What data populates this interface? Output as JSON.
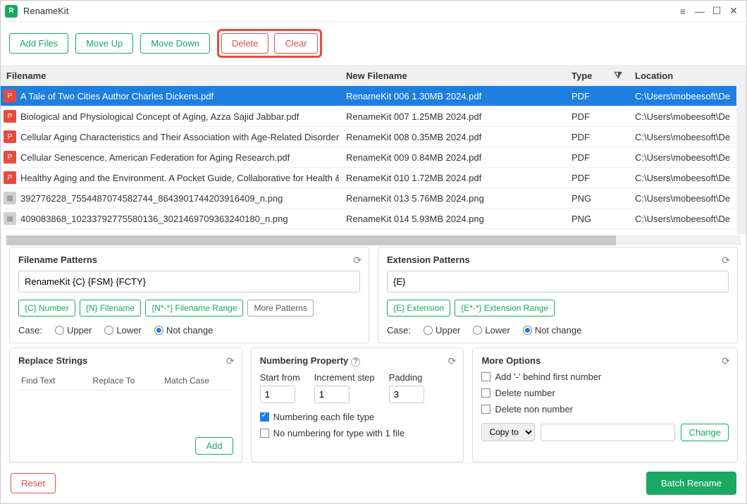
{
  "app": {
    "title": "RenameKit"
  },
  "toolbar": {
    "add_files": "Add Files",
    "move_up": "Move Up",
    "move_down": "Move Down",
    "delete": "Delete",
    "clear": "Clear"
  },
  "grid": {
    "headers": {
      "filename": "Filename",
      "new": "New Filename",
      "type": "Type",
      "loc": "Location"
    },
    "rows": [
      {
        "icon": "pdf",
        "filename": "A Tale of Two Cities Author Charles Dickens.pdf",
        "new": "RenameKit 006 1.30MB 2024.pdf",
        "type": "PDF",
        "loc": "C:\\Users\\mobeesoft\\De",
        "selected": true
      },
      {
        "icon": "pdf",
        "filename": "Biological and Physiological Concept of Aging, Azza Sajid Jabbar.pdf",
        "new": "RenameKit 007 1.25MB 2024.pdf",
        "type": "PDF",
        "loc": "C:\\Users\\mobeesoft\\De"
      },
      {
        "icon": "pdf",
        "filename": "Cellular Aging Characteristics and Their Association with Age-Related Disorders",
        "new": "RenameKit 008 0.35MB 2024.pdf",
        "type": "PDF",
        "loc": "C:\\Users\\mobeesoft\\De"
      },
      {
        "icon": "pdf",
        "filename": "Cellular Senescence, American Federation for Aging Research.pdf",
        "new": "RenameKit 009 0.84MB 2024.pdf",
        "type": "PDF",
        "loc": "C:\\Users\\mobeesoft\\De"
      },
      {
        "icon": "pdf",
        "filename": "Healthy Aging and the Environment. A Pocket Guide, Collaborative for Health &",
        "new": "RenameKit 010 1.72MB 2024.pdf",
        "type": "PDF",
        "loc": "C:\\Users\\mobeesoft\\De"
      },
      {
        "icon": "png",
        "filename": "392776228_7554487074582744_8643901744203916409_n.png",
        "new": "RenameKit 013 5.76MB 2024.png",
        "type": "PNG",
        "loc": "C:\\Users\\mobeesoft\\De"
      },
      {
        "icon": "png",
        "filename": "409083868_10233792775580136_3021469709363240180_n.png",
        "new": "RenameKit 014 5.93MB 2024.png",
        "type": "PNG",
        "loc": "C:\\Users\\mobeesoft\\De"
      }
    ]
  },
  "filename_patterns": {
    "title": "Filename Patterns",
    "value": "RenameKit {C} {FSM} {FCTY}",
    "tokens": {
      "c": "{C} Number",
      "n": "{N} Filename",
      "range": "{N*-*} Filename Range",
      "more": "More Patterns"
    },
    "case_label": "Case:",
    "upper": "Upper",
    "lower": "Lower",
    "notchange": "Not change"
  },
  "extension_patterns": {
    "title": "Extension Patterns",
    "value": "{E}",
    "tokens": {
      "e": "{E} Extension",
      "range": "{E*-*} Extension Range"
    },
    "case_label": "Case:",
    "upper": "Upper",
    "lower": "Lower",
    "notchange": "Not change"
  },
  "replace": {
    "title": "Replace Strings",
    "find": "Find Text",
    "to": "Replace To",
    "match": "Match Case",
    "add": "Add"
  },
  "numbering": {
    "title": "Numbering Property",
    "start_label": "Start from",
    "start_val": "1",
    "step_label": "Increment step",
    "step_val": "1",
    "pad_label": "Padding",
    "pad_val": "3",
    "each_type": "Numbering each file type",
    "no_single": "No numbering for type with 1 file"
  },
  "more": {
    "title": "More Options",
    "dash": "Add '-' behind first number",
    "del_num": "Delete number",
    "del_non": "Delete non number",
    "copy_label": "Copy to",
    "change": "Change"
  },
  "footer": {
    "reset": "Reset",
    "batch": "Batch Rename"
  }
}
